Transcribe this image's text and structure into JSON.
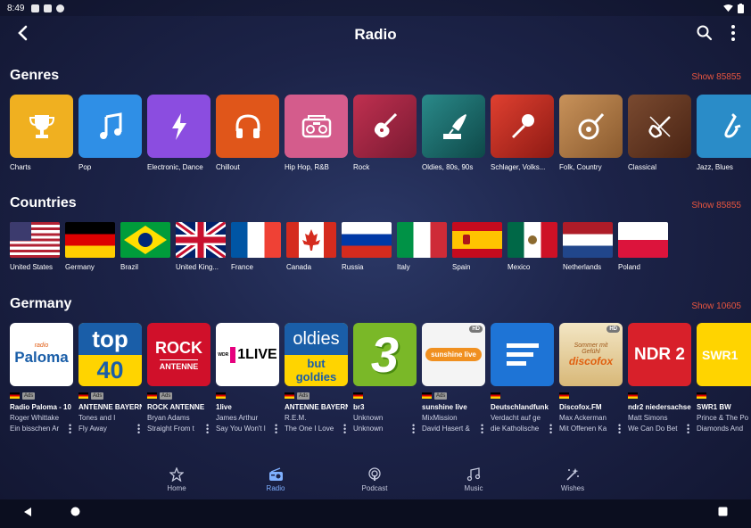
{
  "status_bar": {
    "time": "8:49"
  },
  "app_bar": {
    "title": "Radio"
  },
  "sections": {
    "genres": {
      "title": "Genres",
      "show": "Show 85855"
    },
    "countries": {
      "title": "Countries",
      "show": "Show 85855"
    },
    "germany": {
      "title": "Germany",
      "show": "Show 10605"
    }
  },
  "genres": [
    {
      "label": "Charts",
      "icon": "trophy-icon",
      "color": "#f0b020"
    },
    {
      "label": "Pop",
      "icon": "music-note-icon",
      "color": "#2f8fe6"
    },
    {
      "label": "Electronic, Dance",
      "icon": "lightning-icon",
      "color": "#8b4de0"
    },
    {
      "label": "Chillout",
      "icon": "headphones-icon",
      "color": "#e0561a"
    },
    {
      "label": "Hip Hop, R&B",
      "icon": "boombox-icon",
      "color": "#d45c8c"
    },
    {
      "label": "Rock",
      "icon": "electric-guitar-icon",
      "color": "#b0263e"
    },
    {
      "label": "Oldies, 80s, 90s",
      "icon": "gramophone-icon",
      "color": "#1c6e6e"
    },
    {
      "label": "Schlager, Volks...",
      "icon": "microphone-icon",
      "color": "#c0281e"
    },
    {
      "label": "Folk, Country",
      "icon": "banjo-icon",
      "color": "#b0783e"
    },
    {
      "label": "Classical",
      "icon": "violin-icon",
      "color": "#6a3a24"
    },
    {
      "label": "Jazz, Blues",
      "icon": "saxophone-icon",
      "color": "#2a8cc8"
    }
  ],
  "countries": [
    {
      "label": "United States",
      "flag": "us"
    },
    {
      "label": "Germany",
      "flag": "de"
    },
    {
      "label": "Brazil",
      "flag": "br"
    },
    {
      "label": "United King...",
      "flag": "gb"
    },
    {
      "label": "France",
      "flag": "fr"
    },
    {
      "label": "Canada",
      "flag": "ca"
    },
    {
      "label": "Russia",
      "flag": "ru"
    },
    {
      "label": "Italy",
      "flag": "it"
    },
    {
      "label": "Spain",
      "flag": "es"
    },
    {
      "label": "Mexico",
      "flag": "mx"
    },
    {
      "label": "Netherlands",
      "flag": "nl"
    },
    {
      "label": "Poland",
      "flag": "pl"
    }
  ],
  "stations": [
    {
      "name": "Radio Paloma - 10",
      "artist": "Roger Whittake",
      "song": "Ein bisschen Ar",
      "ads": "Ads",
      "hd": "",
      "logo_text": "Paloma",
      "logo_sub": "radio"
    },
    {
      "name": "ANTENNE BAYERN",
      "artist": "Tones and I",
      "song": "Fly Away",
      "ads": "Ads",
      "hd": "",
      "logo_text": "top",
      "logo_sub": "40"
    },
    {
      "name": "ROCK ANTENNE",
      "artist": "Bryan Adams",
      "song": "Straight From t",
      "ads": "Ads",
      "hd": "",
      "logo_text": "ROCK",
      "logo_sub": "ANTENNE"
    },
    {
      "name": "1live",
      "artist": "James Arthur",
      "song": "Say You Won't l",
      "ads": "",
      "hd": "",
      "logo_text": "1LIVE",
      "logo_sub": "WDR"
    },
    {
      "name": "ANTENNE BAYERN",
      "artist": "R.E.M.",
      "song": "The One I Love",
      "ads": "Ads",
      "hd": "",
      "logo_text": "oldies",
      "logo_sub": "but goldies"
    },
    {
      "name": "br3",
      "artist": "Unknown",
      "song": "Unknown",
      "ads": "",
      "hd": "",
      "logo_text": "3",
      "logo_sub": ""
    },
    {
      "name": "sunshine live",
      "artist": "MixMission",
      "song": "David Hasert &",
      "ads": "Ads",
      "hd": "HD",
      "logo_text": "sunshine live",
      "logo_sub": ""
    },
    {
      "name": "Deutschlandfunk",
      "artist": "Verdacht auf ge",
      "song": "die Katholische",
      "ads": "",
      "hd": "",
      "logo_text": "",
      "logo_sub": ""
    },
    {
      "name": "Discofox.FM",
      "artist": "Max Ackerman",
      "song": "Mit Offenen Ka",
      "ads": "",
      "hd": "HD",
      "logo_text": "discofox",
      "logo_sub": "Sommer mit Gefühl"
    },
    {
      "name": "ndr2 niedersachse",
      "artist": "Matt Simons",
      "song": "We Can Do Bet",
      "ads": "",
      "hd": "",
      "logo_text": "NDR 2",
      "logo_sub": ""
    },
    {
      "name": "SWR1 BW",
      "artist": "Prince & The Po",
      "song": "Diamonds And",
      "ads": "",
      "hd": "",
      "logo_text": "SWR1",
      "logo_sub": ""
    }
  ],
  "bottom_nav": [
    {
      "label": "Home",
      "icon": "star-icon"
    },
    {
      "label": "Radio",
      "icon": "radio-icon",
      "active": true
    },
    {
      "label": "Podcast",
      "icon": "podcast-icon"
    },
    {
      "label": "Music",
      "icon": "music-icon"
    },
    {
      "label": "Wishes",
      "icon": "magic-wand-icon"
    }
  ]
}
